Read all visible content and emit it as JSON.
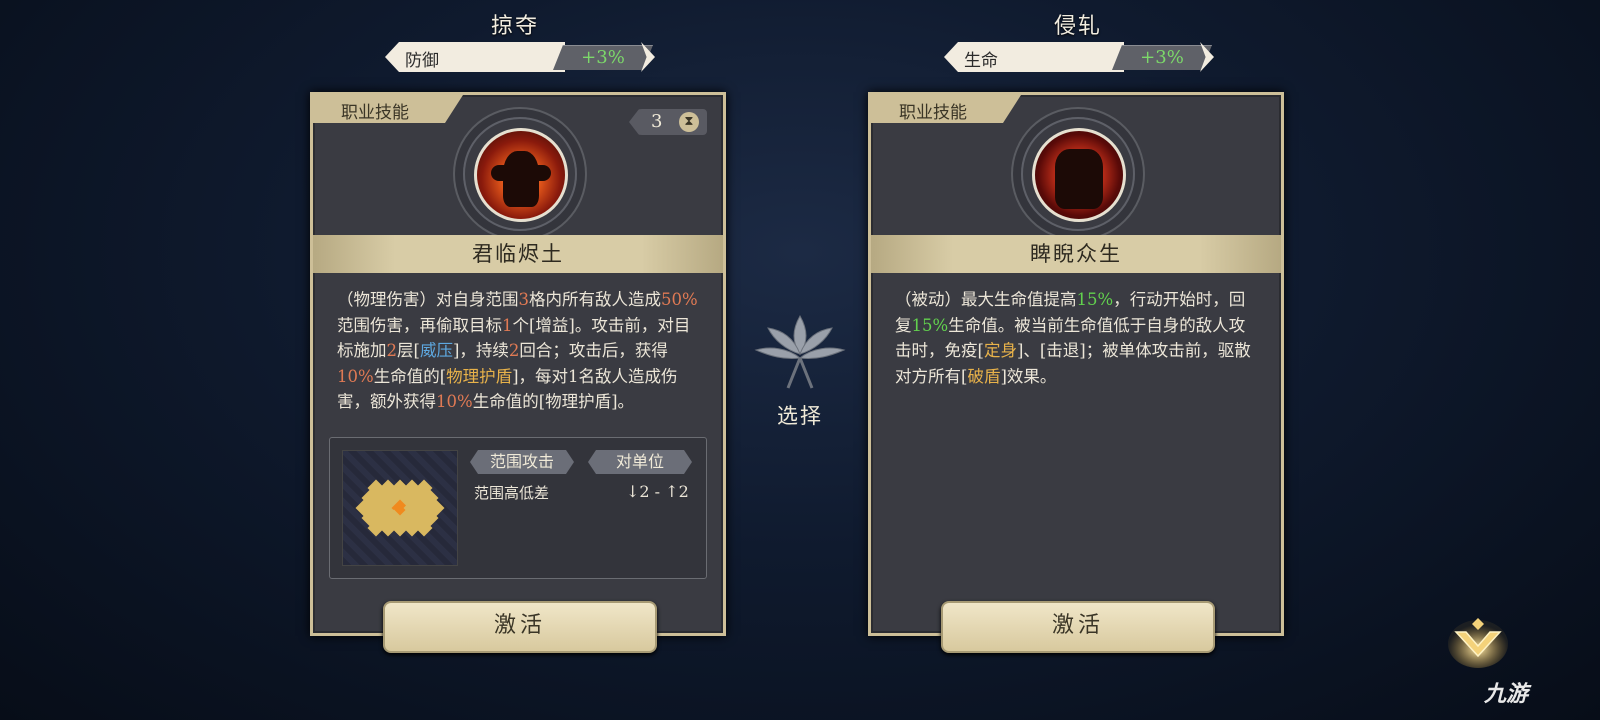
{
  "left": {
    "class_title": "掠夺",
    "bonus_label": "防御",
    "bonus_value": "+3%",
    "tag": "职业技能",
    "cooldown": "3",
    "skill_name": "君临烬土",
    "desc": [
      {
        "t": "（物理伤害）对自身范围"
      },
      {
        "t": "3",
        "c": "hl-red"
      },
      {
        "t": "格内所有敌人造成"
      },
      {
        "t": "50%",
        "c": "hl-red"
      },
      {
        "t": "范围伤害，再偷取目标"
      },
      {
        "t": "1",
        "c": "hl-red"
      },
      {
        "t": "个[增益]。攻击前，对目标施加"
      },
      {
        "t": "2",
        "c": "hl-red"
      },
      {
        "t": "层["
      },
      {
        "t": "威压",
        "c": "hl-blue"
      },
      {
        "t": "]，持续"
      },
      {
        "t": "2",
        "c": "hl-red"
      },
      {
        "t": "回合；攻击后，获得"
      },
      {
        "t": "10%",
        "c": "hl-red"
      },
      {
        "t": "生命值的["
      },
      {
        "t": "物理护盾",
        "c": "hl-gold"
      },
      {
        "t": "]，每对1名敌人造成伤害，额外获得"
      },
      {
        "t": "10%",
        "c": "hl-red"
      },
      {
        "t": "生命值的[物理护盾]。"
      }
    ],
    "range_tag1": "范围攻击",
    "range_tag2": "对单位",
    "range_label": "范围高低差",
    "range_value": "↓2 - ↑2",
    "button": "激活"
  },
  "right": {
    "class_title": "侵轧",
    "bonus_label": "生命",
    "bonus_value": "+3%",
    "tag": "职业技能",
    "skill_name": "睥睨众生",
    "desc": [
      {
        "t": "（被动）最大生命值提高"
      },
      {
        "t": "15%",
        "c": "hl-green"
      },
      {
        "t": "，行动开始时，回复"
      },
      {
        "t": "15%",
        "c": "hl-green"
      },
      {
        "t": "生命值。被当前生命值低于自身的敌人攻击时，免疫["
      },
      {
        "t": "定身",
        "c": "hl-gold"
      },
      {
        "t": "]、[击退]；被单体攻击前，驱散对方所有["
      },
      {
        "t": "破盾",
        "c": "hl-gold"
      },
      {
        "t": "]效果。"
      }
    ],
    "button": "激活"
  },
  "center": {
    "select_label": "选择"
  },
  "watermark": "九游"
}
